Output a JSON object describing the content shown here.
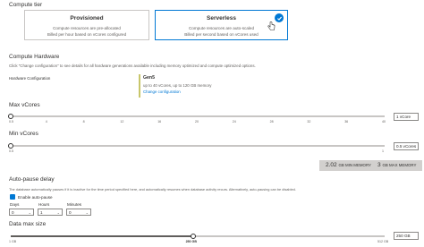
{
  "compute_tier": {
    "heading": "Compute tier",
    "provisioned": {
      "title": "Provisioned",
      "line1": "Compute resources are pre-allocated",
      "line2": "Billed per hour based on vCores configured"
    },
    "serverless": {
      "title": "Serverless",
      "line1": "Compute resources are auto-scaled",
      "line2": "Billed per second based on vCores used",
      "selected": true
    }
  },
  "compute_hardware": {
    "heading": "Compute Hardware",
    "description": "Click \"Change configuration\" to see details for all hardware generations available including memory optimized and compute optimized options.",
    "config_label": "Hardware Configuration",
    "gen_name": "Gen5",
    "gen_detail": "up to 40 vCores, up to 120 GB memory",
    "change_link": "Change configuration"
  },
  "max_vcores": {
    "label": "Max vCores",
    "value": "1 vCore",
    "ticks": [
      "0.5",
      "4",
      "8",
      "12",
      "16",
      "20",
      "24",
      "28",
      "32",
      "36",
      "40"
    ],
    "fraction": 0.0
  },
  "min_vcores": {
    "label": "Min vCores",
    "value": "0.5 vCores",
    "tick_start": "0.5",
    "tick_end": "1",
    "fraction": 0.0
  },
  "memory": {
    "min_value": "2.02",
    "min_unit": "GB MIN MEMORY",
    "max_value": "3",
    "max_unit": "GB MAX MEMORY"
  },
  "auto_pause": {
    "heading": "Auto-pause delay",
    "description": "The database automatically pauses if it is inactive for the time period specified here, and automatically resumes when database activity recurs. Alternatively, auto-pausing can be disabled.",
    "enable_label": "Enable auto-pause",
    "enabled": true,
    "days_label": "Days",
    "days_value": "0",
    "hours_label": "Hours",
    "hours_value": "1",
    "minutes_label": "Minutes",
    "minutes_value": "0"
  },
  "data_max_size": {
    "label": "Data max size",
    "tick_start": "1 GB",
    "tick_mid": "250 GB",
    "tick_end": "512 GB",
    "value": "250 GB",
    "fraction": 0.487
  },
  "colors": {
    "accent": "#0078d4",
    "selected_tier_bar": "#c8c66a"
  }
}
